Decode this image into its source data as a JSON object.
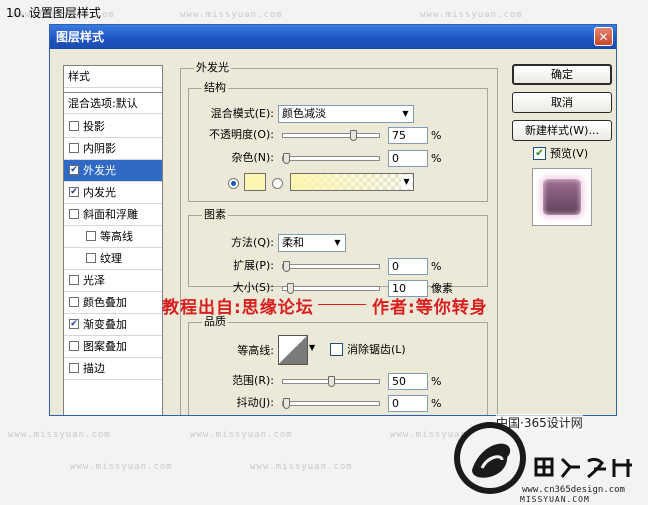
{
  "step_title": "10. 设置图层样式",
  "watermark": "www.missyuan.com",
  "bottom_text": "www.cn365design.com",
  "bottom_brand": "MISSYUAN.COM",
  "site_name": "中国·365设计网",
  "dialog": {
    "title": "图层样式",
    "close_glyph": "✕",
    "styles_header": "样式",
    "blend_options": "混合选项:默认",
    "styles": [
      {
        "label": "投影",
        "checked": false,
        "indent": false,
        "selected": false
      },
      {
        "label": "内阴影",
        "checked": false,
        "indent": false,
        "selected": false
      },
      {
        "label": "外发光",
        "checked": true,
        "indent": false,
        "selected": true
      },
      {
        "label": "内发光",
        "checked": true,
        "indent": false,
        "selected": false
      },
      {
        "label": "斜面和浮雕",
        "checked": false,
        "indent": false,
        "selected": false
      },
      {
        "label": "等高线",
        "checked": false,
        "indent": true,
        "selected": false
      },
      {
        "label": "纹理",
        "checked": false,
        "indent": true,
        "selected": false
      },
      {
        "label": "光泽",
        "checked": false,
        "indent": false,
        "selected": false
      },
      {
        "label": "颜色叠加",
        "checked": false,
        "indent": false,
        "selected": false
      },
      {
        "label": "渐变叠加",
        "checked": true,
        "indent": false,
        "selected": false
      },
      {
        "label": "图案叠加",
        "checked": false,
        "indent": false,
        "selected": false
      },
      {
        "label": "描边",
        "checked": false,
        "indent": false,
        "selected": false
      }
    ],
    "section_title": "外发光",
    "structure": {
      "title": "结构",
      "blend_mode_label": "混合模式(E):",
      "blend_mode_value": "颜色减淡",
      "opacity_label": "不透明度(O):",
      "opacity_value": "75",
      "opacity_fraction": 0.75,
      "noise_label": "杂色(N):",
      "noise_value": "0",
      "noise_fraction": 0,
      "percent": "%",
      "glow_color": "#fdf6b0"
    },
    "elements": {
      "title": "图素",
      "method_label": "方法(Q):",
      "method_value": "柔和",
      "spread_label": "扩展(P):",
      "spread_value": "0",
      "spread_fraction": 0,
      "size_label": "大小(S):",
      "size_value": "10",
      "size_fraction": 0.04,
      "size_unit": "像素"
    },
    "quality": {
      "title": "品质",
      "contour_label": "等高线:",
      "antialias_label": "消除锯齿(L)",
      "range_label": "范围(R):",
      "range_value": "50",
      "range_fraction": 0.5,
      "jitter_label": "抖动(J):",
      "jitter_value": "0",
      "jitter_fraction": 0
    },
    "buttons": {
      "ok": "确定",
      "cancel": "取消",
      "new_style": "新建样式(W)...",
      "preview": "预览(V)"
    }
  },
  "overlay": {
    "source": "教程出自:思缘论坛",
    "author": "作者:等你转身"
  },
  "colors": {
    "titlebar": "#1f56c4",
    "selection": "#3169c6",
    "overlay_text": "#d81e1e"
  }
}
